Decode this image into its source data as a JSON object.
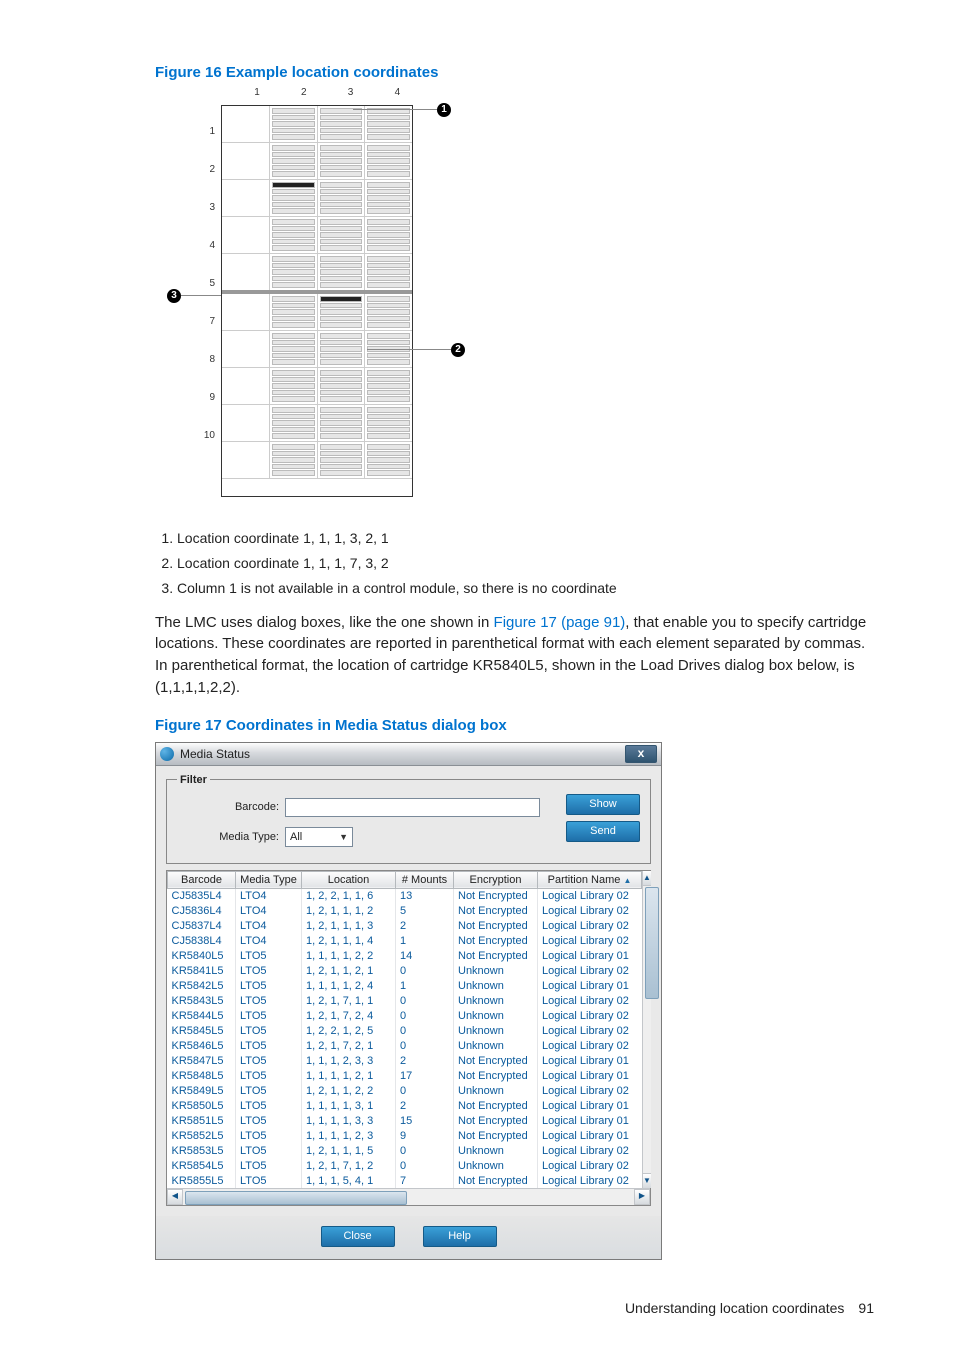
{
  "figure16": {
    "caption": "Figure 16 Example location coordinates",
    "cols": [
      "1",
      "2",
      "3",
      "4"
    ],
    "rows": [
      "1",
      "2",
      "3",
      "4",
      "5",
      "7",
      "8",
      "9",
      "10"
    ],
    "callouts": [
      "1",
      "2",
      "3"
    ],
    "notes": [
      "Location coordinate 1, 1, 1, 3, 2, 1",
      "Location coordinate 1, 1, 1, 7, 3, 2",
      "Column 1 is not available in a control module, so there is no coordinate"
    ]
  },
  "paragraph": {
    "pre": "The LMC uses dialog boxes, like the one shown in ",
    "link": "Figure 17 (page 91)",
    "post": ", that enable you to specify cartridge locations. These coordinates are reported in parenthetical format with each element separated by commas. In parenthetical format, the location of cartridge KR5840L5, shown in the Load Drives dialog box below, is (1,1,1,1,2,2)."
  },
  "figure17": {
    "caption": "Figure 17 Coordinates in Media Status dialog box",
    "dialog_title": "Media Status",
    "close_x": "x",
    "filter_legend": "Filter",
    "barcode_label": "Barcode:",
    "mediatype_label": "Media Type:",
    "mediatype_value": "All",
    "show_btn": "Show",
    "send_btn": "Send",
    "close_btn": "Close",
    "help_btn": "Help",
    "headers": [
      "Barcode",
      "Media Type",
      "Location",
      "# Mounts",
      "Encryption",
      "Partition Name"
    ],
    "rows": [
      [
        "CJ5835L4",
        "LTO4",
        "1, 2, 2, 1, 1, 6",
        "13",
        "Not Encrypted",
        "Logical Library 02"
      ],
      [
        "CJ5836L4",
        "LTO4",
        "1, 2, 1, 1, 1, 2",
        "5",
        "Not Encrypted",
        "Logical Library 02"
      ],
      [
        "CJ5837L4",
        "LTO4",
        "1, 2, 1, 1, 1, 3",
        "2",
        "Not Encrypted",
        "Logical Library 02"
      ],
      [
        "CJ5838L4",
        "LTO4",
        "1, 2, 1, 1, 1, 4",
        "1",
        "Not Encrypted",
        "Logical Library 02"
      ],
      [
        "KR5840L5",
        "LTO5",
        "1, 1, 1, 1, 2, 2",
        "14",
        "Not Encrypted",
        "Logical Library 01"
      ],
      [
        "KR5841L5",
        "LTO5",
        "1, 2, 1, 1, 2, 1",
        "0",
        "Unknown",
        "Logical Library 02"
      ],
      [
        "KR5842L5",
        "LTO5",
        "1, 1, 1, 1, 2, 4",
        "1",
        "Unknown",
        "Logical Library 01"
      ],
      [
        "KR5843L5",
        "LTO5",
        "1, 2, 1, 7, 1, 1",
        "0",
        "Unknown",
        "Logical Library 02"
      ],
      [
        "KR5844L5",
        "LTO5",
        "1, 2, 1, 7, 2, 4",
        "0",
        "Unknown",
        "Logical Library 02"
      ],
      [
        "KR5845L5",
        "LTO5",
        "1, 2, 2, 1, 2, 5",
        "0",
        "Unknown",
        "Logical Library 02"
      ],
      [
        "KR5846L5",
        "LTO5",
        "1, 2, 1, 7, 2, 1",
        "0",
        "Unknown",
        "Logical Library 02"
      ],
      [
        "KR5847L5",
        "LTO5",
        "1, 1, 1, 2, 3, 3",
        "2",
        "Not Encrypted",
        "Logical Library 01"
      ],
      [
        "KR5848L5",
        "LTO5",
        "1, 1, 1, 1, 2, 1",
        "17",
        "Not Encrypted",
        "Logical Library 01"
      ],
      [
        "KR5849L5",
        "LTO5",
        "1, 2, 1, 1, 2, 2",
        "0",
        "Unknown",
        "Logical Library 02"
      ],
      [
        "KR5850L5",
        "LTO5",
        "1, 1, 1, 1, 3, 1",
        "2",
        "Not Encrypted",
        "Logical Library 01"
      ],
      [
        "KR5851L5",
        "LTO5",
        "1, 1, 1, 1, 3, 3",
        "15",
        "Not Encrypted",
        "Logical Library 01"
      ],
      [
        "KR5852L5",
        "LTO5",
        "1, 1, 1, 1, 2, 3",
        "9",
        "Not Encrypted",
        "Logical Library 01"
      ],
      [
        "KR5853L5",
        "LTO5",
        "1, 2, 1, 1, 1, 5",
        "0",
        "Unknown",
        "Logical Library 02"
      ],
      [
        "KR5854L5",
        "LTO5",
        "1, 2, 1, 7, 1, 2",
        "0",
        "Unknown",
        "Logical Library 02"
      ],
      [
        "KR5855L5",
        "LTO5",
        "1, 1, 1, 5, 4, 1",
        "7",
        "Not Encrypted",
        "Logical Library 02"
      ]
    ]
  },
  "footer": {
    "section": "Understanding location coordinates",
    "page": "91"
  },
  "chart_data": {
    "type": "table",
    "title": "Media Status",
    "columns": [
      "Barcode",
      "Media Type",
      "Location",
      "# Mounts",
      "Encryption",
      "Partition Name"
    ],
    "rows": [
      [
        "CJ5835L4",
        "LTO4",
        "1, 2, 2, 1, 1, 6",
        13,
        "Not Encrypted",
        "Logical Library 02"
      ],
      [
        "CJ5836L4",
        "LTO4",
        "1, 2, 1, 1, 1, 2",
        5,
        "Not Encrypted",
        "Logical Library 02"
      ],
      [
        "CJ5837L4",
        "LTO4",
        "1, 2, 1, 1, 1, 3",
        2,
        "Not Encrypted",
        "Logical Library 02"
      ],
      [
        "CJ5838L4",
        "LTO4",
        "1, 2, 1, 1, 1, 4",
        1,
        "Not Encrypted",
        "Logical Library 02"
      ],
      [
        "KR5840L5",
        "LTO5",
        "1, 1, 1, 1, 2, 2",
        14,
        "Not Encrypted",
        "Logical Library 01"
      ],
      [
        "KR5841L5",
        "LTO5",
        "1, 2, 1, 1, 2, 1",
        0,
        "Unknown",
        "Logical Library 02"
      ],
      [
        "KR5842L5",
        "LTO5",
        "1, 1, 1, 1, 2, 4",
        1,
        "Unknown",
        "Logical Library 01"
      ],
      [
        "KR5843L5",
        "LTO5",
        "1, 2, 1, 7, 1, 1",
        0,
        "Unknown",
        "Logical Library 02"
      ],
      [
        "KR5844L5",
        "LTO5",
        "1, 2, 1, 7, 2, 4",
        0,
        "Unknown",
        "Logical Library 02"
      ],
      [
        "KR5845L5",
        "LTO5",
        "1, 2, 2, 1, 2, 5",
        0,
        "Unknown",
        "Logical Library 02"
      ],
      [
        "KR5846L5",
        "LTO5",
        "1, 2, 1, 7, 2, 1",
        0,
        "Unknown",
        "Logical Library 02"
      ],
      [
        "KR5847L5",
        "LTO5",
        "1, 1, 1, 2, 3, 3",
        2,
        "Not Encrypted",
        "Logical Library 01"
      ],
      [
        "KR5848L5",
        "LTO5",
        "1, 1, 1, 1, 2, 1",
        17,
        "Not Encrypted",
        "Logical Library 01"
      ],
      [
        "KR5849L5",
        "LTO5",
        "1, 2, 1, 1, 2, 2",
        0,
        "Unknown",
        "Logical Library 02"
      ],
      [
        "KR5850L5",
        "LTO5",
        "1, 1, 1, 1, 3, 1",
        2,
        "Not Encrypted",
        "Logical Library 01"
      ],
      [
        "KR5851L5",
        "LTO5",
        "1, 1, 1, 1, 3, 3",
        15,
        "Not Encrypted",
        "Logical Library 01"
      ],
      [
        "KR5852L5",
        "LTO5",
        "1, 1, 1, 1, 2, 3",
        9,
        "Not Encrypted",
        "Logical Library 01"
      ],
      [
        "KR5853L5",
        "LTO5",
        "1, 2, 1, 1, 1, 5",
        0,
        "Unknown",
        "Logical Library 02"
      ],
      [
        "KR5854L5",
        "LTO5",
        "1, 2, 1, 7, 1, 2",
        0,
        "Unknown",
        "Logical Library 02"
      ],
      [
        "KR5855L5",
        "LTO5",
        "1, 1, 1, 5, 4, 1",
        7,
        "Not Encrypted",
        "Logical Library 02"
      ]
    ]
  }
}
